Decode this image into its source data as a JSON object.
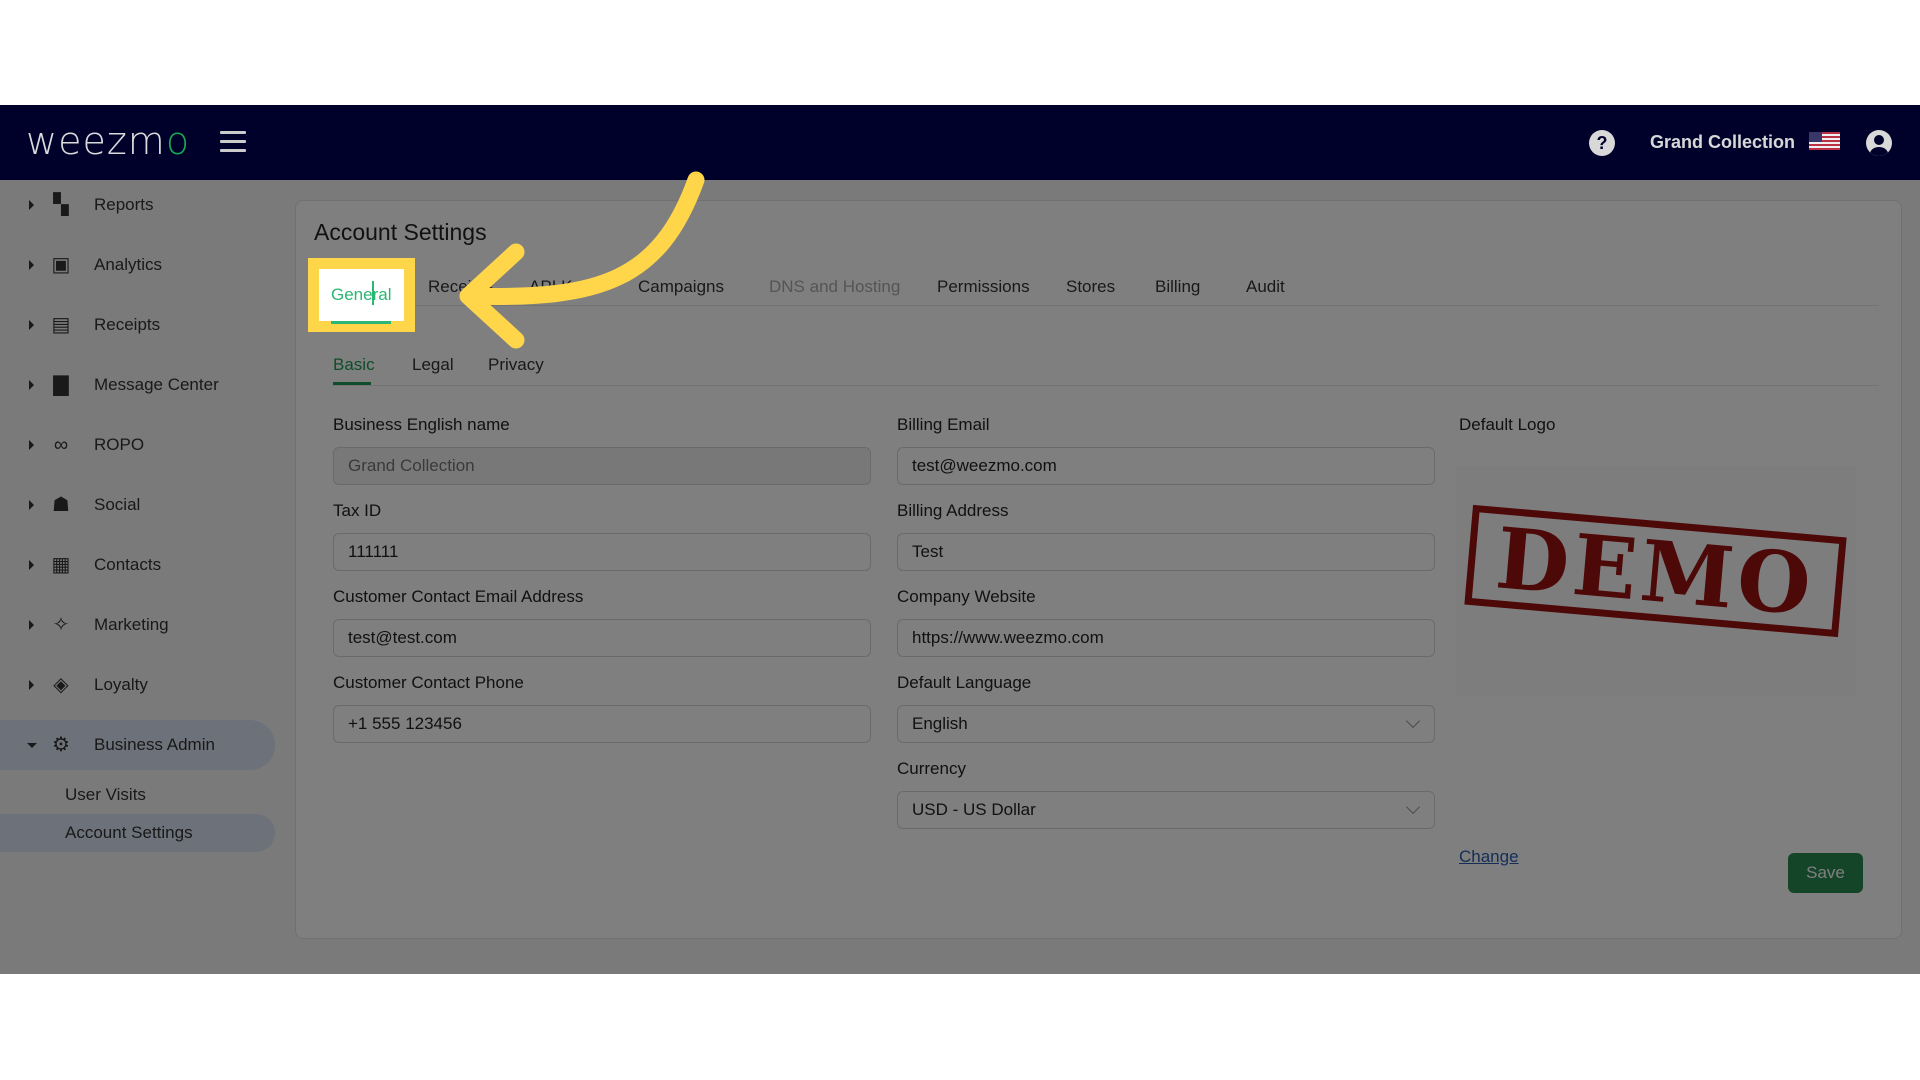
{
  "header": {
    "logo_text": "weezm",
    "logo_accent": "o",
    "store_name": "Grand Collection",
    "help_icon": "?",
    "flag": "us-flag",
    "colors": {
      "background": "#00022e",
      "accent": "#19b35a"
    }
  },
  "sidebar": {
    "items": [
      {
        "label": "Reports",
        "icon": "dashboard-icon",
        "glyph": "▚"
      },
      {
        "label": "Analytics",
        "icon": "bar-chart-icon",
        "glyph": "▣"
      },
      {
        "label": "Receipts",
        "icon": "receipt-icon",
        "glyph": "▤"
      },
      {
        "label": "Message Center",
        "icon": "chat-icon",
        "glyph": "▇"
      },
      {
        "label": "ROPO",
        "icon": "infinity-icon",
        "glyph": "∞"
      },
      {
        "label": "Social",
        "icon": "people-icon",
        "glyph": "☗"
      },
      {
        "label": "Contacts",
        "icon": "contact-card-icon",
        "glyph": "▦"
      },
      {
        "label": "Marketing",
        "icon": "party-popper-icon",
        "glyph": "✧"
      },
      {
        "label": "Loyalty",
        "icon": "tag-heart-icon",
        "glyph": "◈"
      },
      {
        "label": "Business Admin",
        "icon": "gear-icon",
        "glyph": "⚙"
      }
    ],
    "sub_items": [
      {
        "label": "User Visits"
      },
      {
        "label": "Account Settings"
      }
    ]
  },
  "page": {
    "title": "Account Settings",
    "tabs": [
      {
        "label": "General",
        "state": "active"
      },
      {
        "label": "Receipts",
        "state": "normal"
      },
      {
        "label": "API Keys",
        "state": "normal"
      },
      {
        "label": "Campaigns",
        "state": "normal"
      },
      {
        "label": "DNS and Hosting",
        "state": "disabled"
      },
      {
        "label": "Permissions",
        "state": "normal"
      },
      {
        "label": "Stores",
        "state": "normal"
      },
      {
        "label": "Billing",
        "state": "normal"
      },
      {
        "label": "Audit",
        "state": "normal"
      }
    ],
    "subtabs": [
      {
        "label": "Basic",
        "state": "active"
      },
      {
        "label": "Legal",
        "state": "normal"
      },
      {
        "label": "Privacy",
        "state": "normal"
      }
    ]
  },
  "form": {
    "business_english_name": {
      "label": "Business English name",
      "value": "",
      "placeholder": "Grand Collection",
      "disabled": true
    },
    "tax_id": {
      "label": "Tax ID",
      "value": "111111"
    },
    "customer_contact_email": {
      "label": "Customer Contact Email Address",
      "value": "test@test.com"
    },
    "customer_contact_phone": {
      "label": "Customer Contact Phone",
      "value": "+1 555 123456"
    },
    "billing_email": {
      "label": "Billing Email",
      "value": "test@weezmo.com"
    },
    "billing_address": {
      "label": "Billing Address",
      "value": "Test"
    },
    "company_website": {
      "label": "Company Website",
      "value": "https://www.weezmo.com"
    },
    "default_language": {
      "label": "Default Language",
      "value": "English"
    },
    "currency": {
      "label": "Currency",
      "value": "USD - US Dollar"
    },
    "default_logo": {
      "label": "Default Logo",
      "image_text": "DEMO",
      "change_label": "Change"
    },
    "save_label": "Save"
  },
  "annotation": {
    "highlighted_tab": "General",
    "highlight_color": "#ffd54a"
  }
}
